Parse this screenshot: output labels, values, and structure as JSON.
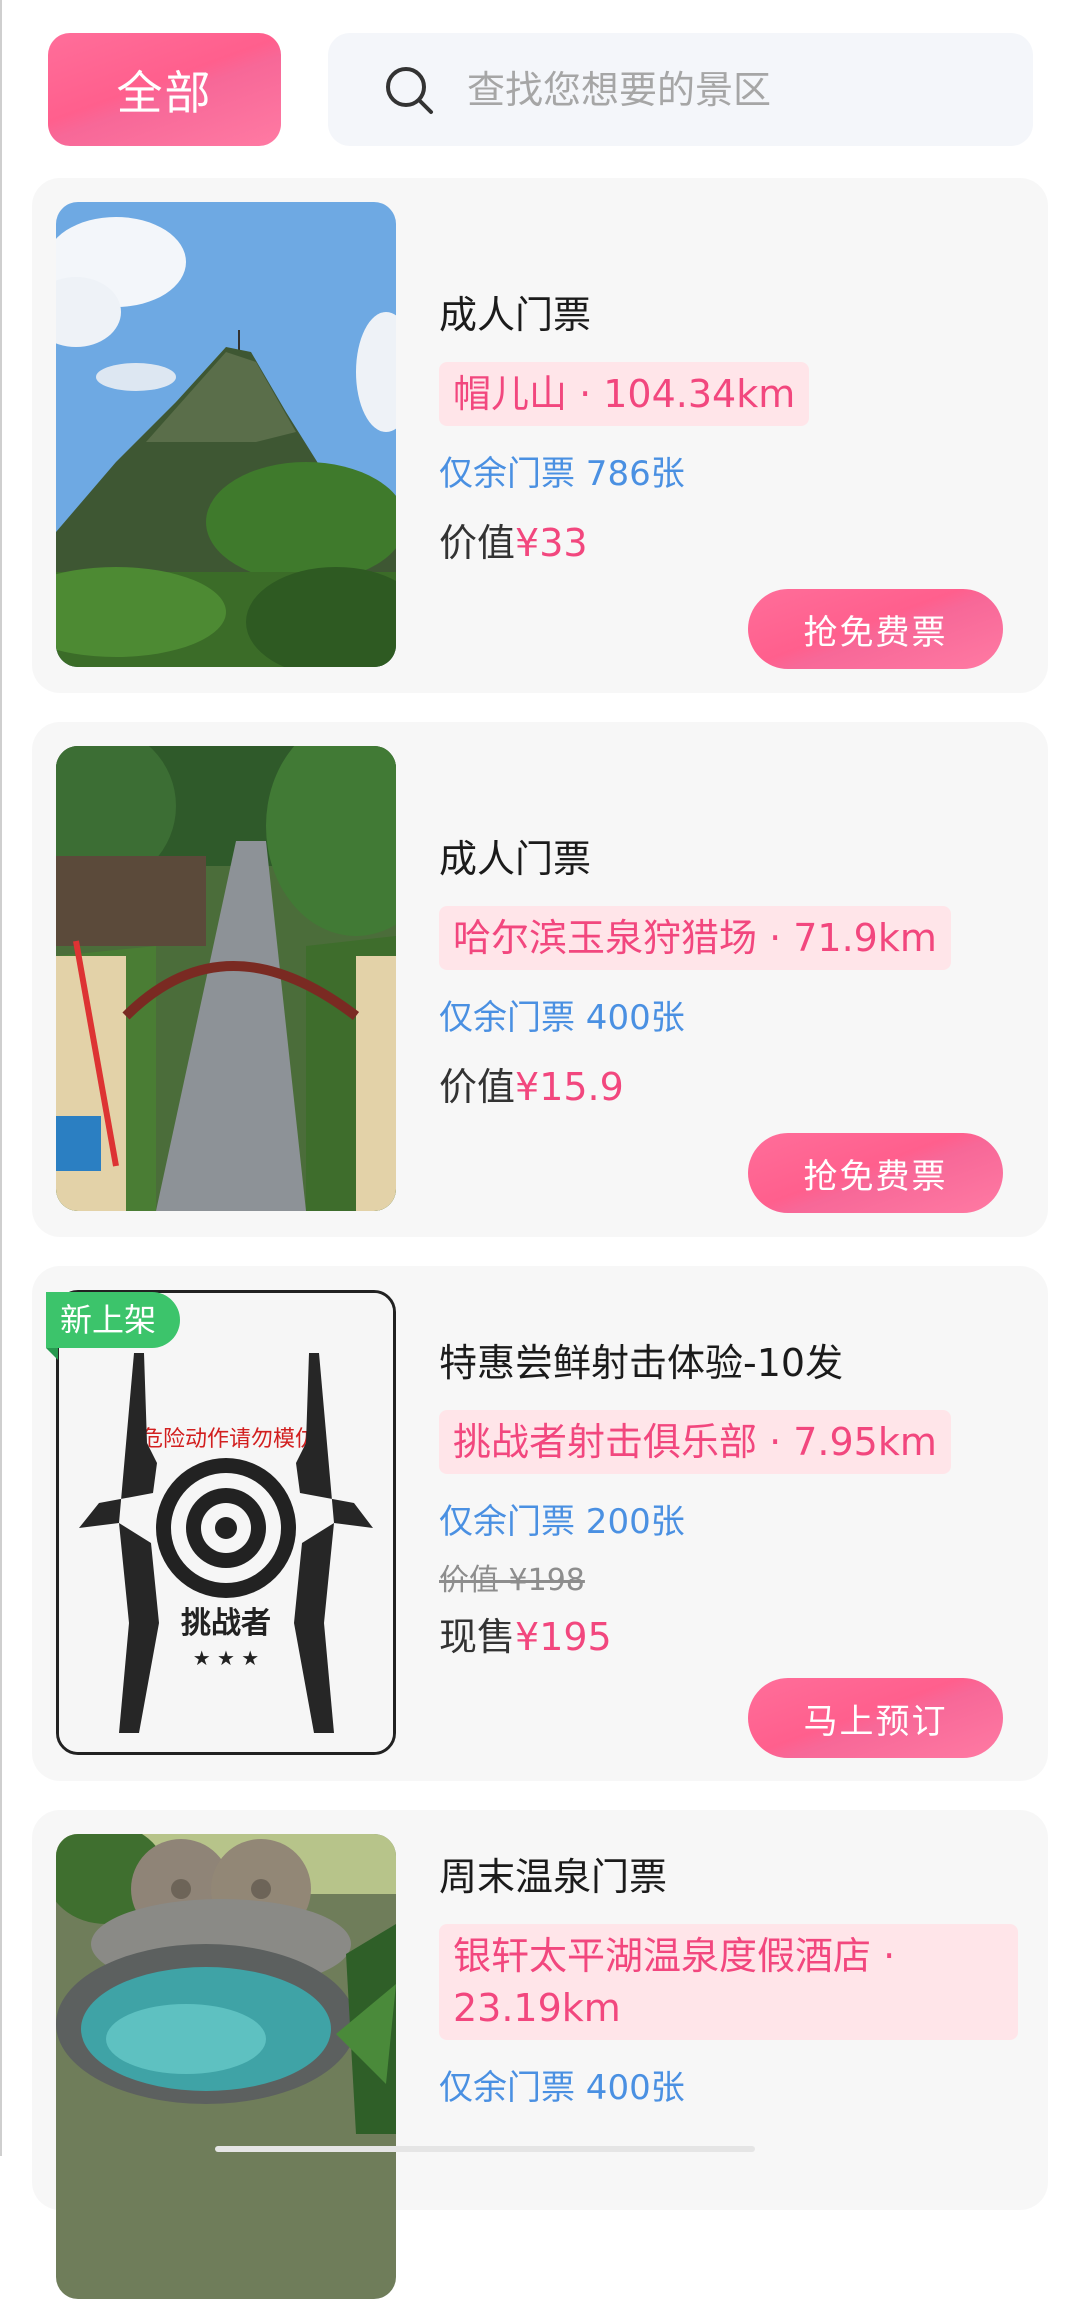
{
  "header": {
    "filter_label": "全部",
    "search_placeholder": "查找您想要的景区"
  },
  "tickets": [
    {
      "title": "成人门票",
      "place": "帽儿山 · 104.34km",
      "stock": "仅余门票 786张",
      "price_label": "价值",
      "price": "¥33",
      "cta": "抢免费票"
    },
    {
      "title": "成人门票",
      "place": "哈尔滨玉泉狩猎场 · 71.9km",
      "stock": "仅余门票 400张",
      "price_label": "价值",
      "price": "¥15.9",
      "cta": "抢免费票"
    },
    {
      "badge": "新上架",
      "title": "特惠尝鲜射击体验-10发",
      "place": "挑战者射击俱乐部 · 7.95km",
      "stock": "仅余门票 200张",
      "original_price": "价值 ¥198",
      "price_label": "现售",
      "price": "¥195",
      "cta": "马上预订",
      "poster_text": "危险动作请勿模仿",
      "poster_brand": "挑战者"
    },
    {
      "title": "周末温泉门票",
      "place": "银轩太平湖温泉度假酒店 · 23.19km",
      "stock": "仅余门票 400张"
    }
  ],
  "colors": {
    "accent": "#ff5f8d",
    "price": "#f2477e",
    "stock": "#4a90e2",
    "badge": "#3cc46b"
  }
}
